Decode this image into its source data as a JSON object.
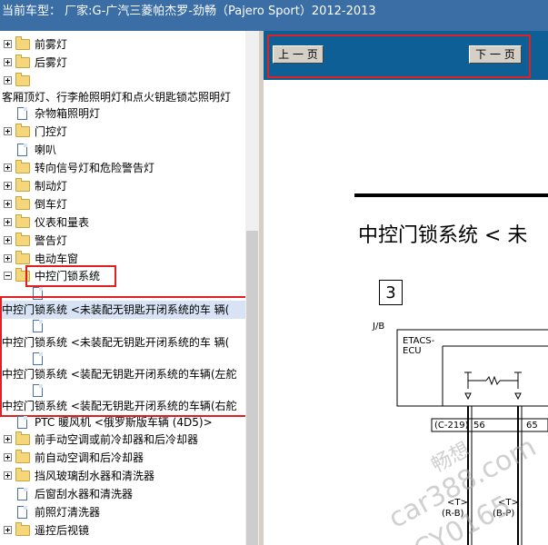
{
  "title_bar": {
    "text": "当前车型：  厂家:G-广汽三菱帕杰罗-劲畅（Pajero Sport）2012-2013"
  },
  "tree": {
    "items": [
      {
        "kind": "folder",
        "label": "前雾灯",
        "expander": "plus"
      },
      {
        "kind": "folder",
        "label": "后雾灯",
        "expander": "plus"
      },
      {
        "kind": "folder",
        "label": "",
        "expander": "plus"
      },
      {
        "kind": "text",
        "label": "客厢顶灯、行李舱照明灯和点火钥匙锁芯照明灯"
      },
      {
        "kind": "doc",
        "label": "杂物箱照明灯"
      },
      {
        "kind": "folder",
        "label": "门控灯",
        "expander": "plus"
      },
      {
        "kind": "doc",
        "label": "喇叭"
      },
      {
        "kind": "folder",
        "label": "转向信号灯和危险警告灯",
        "expander": "plus"
      },
      {
        "kind": "folder",
        "label": "制动灯",
        "expander": "plus"
      },
      {
        "kind": "folder",
        "label": "倒车灯",
        "expander": "plus"
      },
      {
        "kind": "folder",
        "label": "仪表和量表",
        "expander": "plus"
      },
      {
        "kind": "folder",
        "label": "警告灯",
        "expander": "plus"
      },
      {
        "kind": "folder",
        "label": "电动车窗",
        "expander": "plus"
      },
      {
        "kind": "folder",
        "label": "中控门锁系统",
        "expander": "minus"
      },
      {
        "kind": "doc",
        "label": ""
      },
      {
        "kind": "text",
        "label": "中控门锁系统 <未装配无钥匙开闭系统的车 辆("
      },
      {
        "kind": "doc",
        "label": ""
      },
      {
        "kind": "text",
        "label": "中控门锁系统 <未装配无钥匙开闭系统的车 辆("
      },
      {
        "kind": "doc",
        "label": ""
      },
      {
        "kind": "text",
        "label": "中控门锁系统 <装配无钥匙开闭系统的车辆(左舵"
      },
      {
        "kind": "doc",
        "label": ""
      },
      {
        "kind": "text",
        "label": "中控门锁系统 <装配无钥匙开闭系统的车辆(右舵"
      },
      {
        "kind": "doc",
        "label": "PTC 暖风机 <俄罗斯版车辆 (4D5)>"
      },
      {
        "kind": "folder",
        "label": "前手动空调或前冷却器和后冷却器",
        "expander": "plus"
      },
      {
        "kind": "folder",
        "label": "前自动空调和后冷却器",
        "expander": "plus"
      },
      {
        "kind": "folder",
        "label": "挡风玻璃刮水器和清洗器",
        "expander": "plus"
      },
      {
        "kind": "doc",
        "label": "后窗刮水器和清洗器"
      },
      {
        "kind": "doc",
        "label": "前照灯清洗器"
      },
      {
        "kind": "folder",
        "label": "遥控后视镜",
        "expander": "plus"
      }
    ]
  },
  "toolbar": {
    "prev_label": "上 一 页",
    "next_label": "下 一 页"
  },
  "document": {
    "title": "中控门锁系统 < 未",
    "page_box": "3",
    "jb_label": "J/B",
    "ecu_label_1": "ETACS-",
    "ecu_label_2": "ECU",
    "connector": "(C-219)",
    "pin_a": "56",
    "pin_b": "65",
    "wire_a_1": "<T>",
    "wire_a_2": "(R-B)",
    "wire_b_1": "<T>",
    "wire_b_2": "(B-P)"
  },
  "watermark": {
    "line1": "畅想",
    "line2": "car388.com",
    "line3": "CY0165"
  },
  "colors": {
    "title_bar_bg": "#3a6ea5",
    "toolbar_bg": "#0e5f96",
    "highlight_border": "#e02020",
    "selected_row": "#d8e4f5"
  }
}
